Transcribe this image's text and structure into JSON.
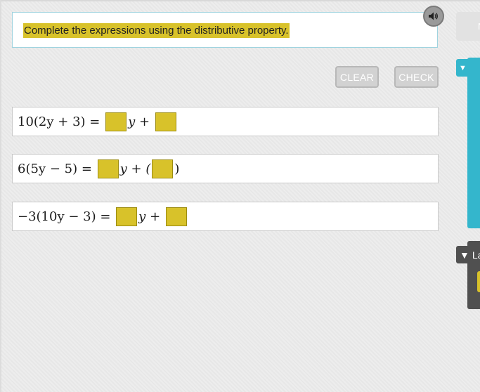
{
  "prompt": {
    "text": "Complete the expressions using the distributive property."
  },
  "audio": {
    "icon": "speaker-icon"
  },
  "buttons": {
    "clear_label": "CLEAR",
    "check_label": "CHECK"
  },
  "problems": [
    {
      "lhs": "10(2y + 3) =",
      "middle": "y +",
      "tail": ""
    },
    {
      "lhs": "6(5y − 5) =",
      "middle": "y + (",
      "tail": ")"
    },
    {
      "lhs": "−3(10y − 3) =",
      "middle": "y +",
      "tail": ""
    }
  ],
  "side_panel": {
    "top_label": "N",
    "dark_tab_label": "La",
    "arrow": "▼"
  },
  "colors": {
    "highlight": "#d8c22a",
    "accent": "#34b6cc"
  }
}
